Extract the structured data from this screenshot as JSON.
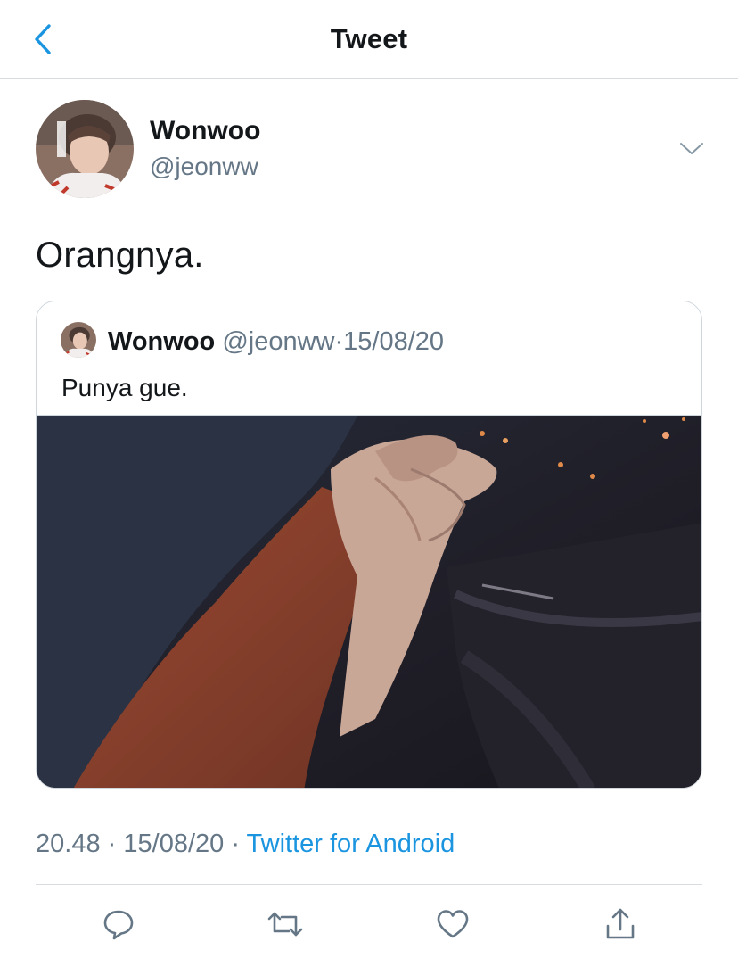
{
  "header": {
    "title": "Tweet",
    "back_icon": "chevron-left-icon"
  },
  "tweet": {
    "author_name": "Wonwoo",
    "author_handle": "@jeonww",
    "text": "Orangnya.",
    "time": "20.48",
    "separator": "·",
    "date": "15/08/20",
    "source": "Twitter for Android"
  },
  "quoted_tweet": {
    "author_name": "Wonwoo",
    "author_handle": "@jeonww",
    "separator": "·",
    "date": "15/08/20",
    "text": "Punya gue."
  },
  "actions": [
    {
      "icon": "reply-icon"
    },
    {
      "icon": "retweet-icon"
    },
    {
      "icon": "like-icon"
    },
    {
      "icon": "share-icon"
    }
  ],
  "colors": {
    "accent": "#1b95e0",
    "text": "#14171a",
    "secondary_text": "#657786",
    "divider": "#d9dde1"
  }
}
